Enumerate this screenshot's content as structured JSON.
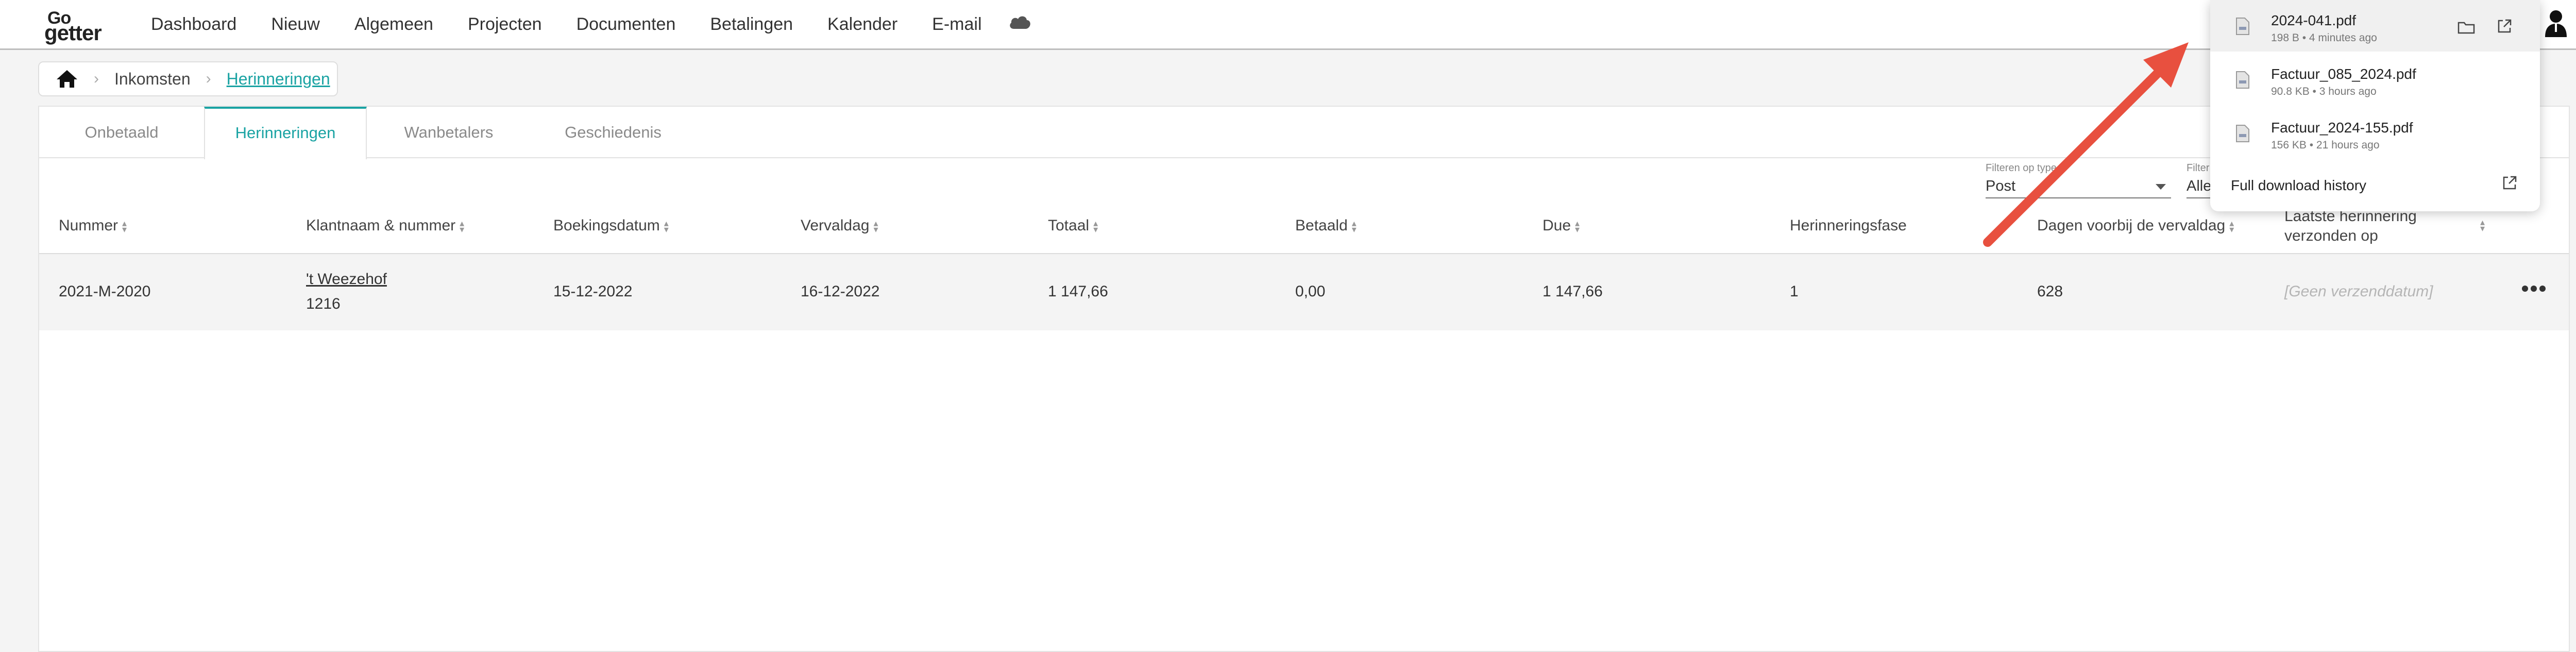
{
  "logo": {
    "line1": "Go",
    "line2": "getter"
  },
  "nav": [
    "Dashboard",
    "Nieuw",
    "Algemeen",
    "Projecten",
    "Documenten",
    "Betalingen",
    "Kalender",
    "E-mail"
  ],
  "breadcrumb": {
    "section": "Inkomsten",
    "current": "Herinneringen"
  },
  "tabs": [
    "Onbetaald",
    "Herinneringen",
    "Wanbetalers",
    "Geschiedenis"
  ],
  "active_tab": "Herinneringen",
  "filters": [
    {
      "label": "Filteren op type",
      "value": "Post"
    },
    {
      "label": "Filter",
      "value": "Alle"
    }
  ],
  "columns": [
    "Nummer",
    "Klantnaam & nummer",
    "Boekingsdatum",
    "Vervaldag",
    "Totaal",
    "Betaald",
    "Due",
    "Herinneringsfase",
    "Dagen voorbij de vervaldag",
    "Laatste herinnering",
    "verzonden op"
  ],
  "row": {
    "nummer": "2021-M-2020",
    "klant_naam": "'t Weezehof",
    "klant_nummer": "1216",
    "boekingsdatum": "15-12-2022",
    "vervaldag": "16-12-2022",
    "totaal": "1 147,66",
    "betaald": "0,00",
    "due": "1 147,66",
    "fase": "1",
    "dagen": "628",
    "verzonden": "[Geen verzenddatum]"
  },
  "downloads": [
    {
      "name": "2024-041.pdf",
      "meta": "198 B • 4 minutes ago"
    },
    {
      "name": "Factuur_085_2024.pdf",
      "meta": "90.8 KB • 3 hours ago"
    },
    {
      "name": "Factuur_2024-155.pdf",
      "meta": "156 KB • 21 hours ago"
    }
  ],
  "downloads_footer": "Full download history",
  "colors": {
    "accent": "#1aa3a3",
    "arrow": "#e8503f"
  }
}
